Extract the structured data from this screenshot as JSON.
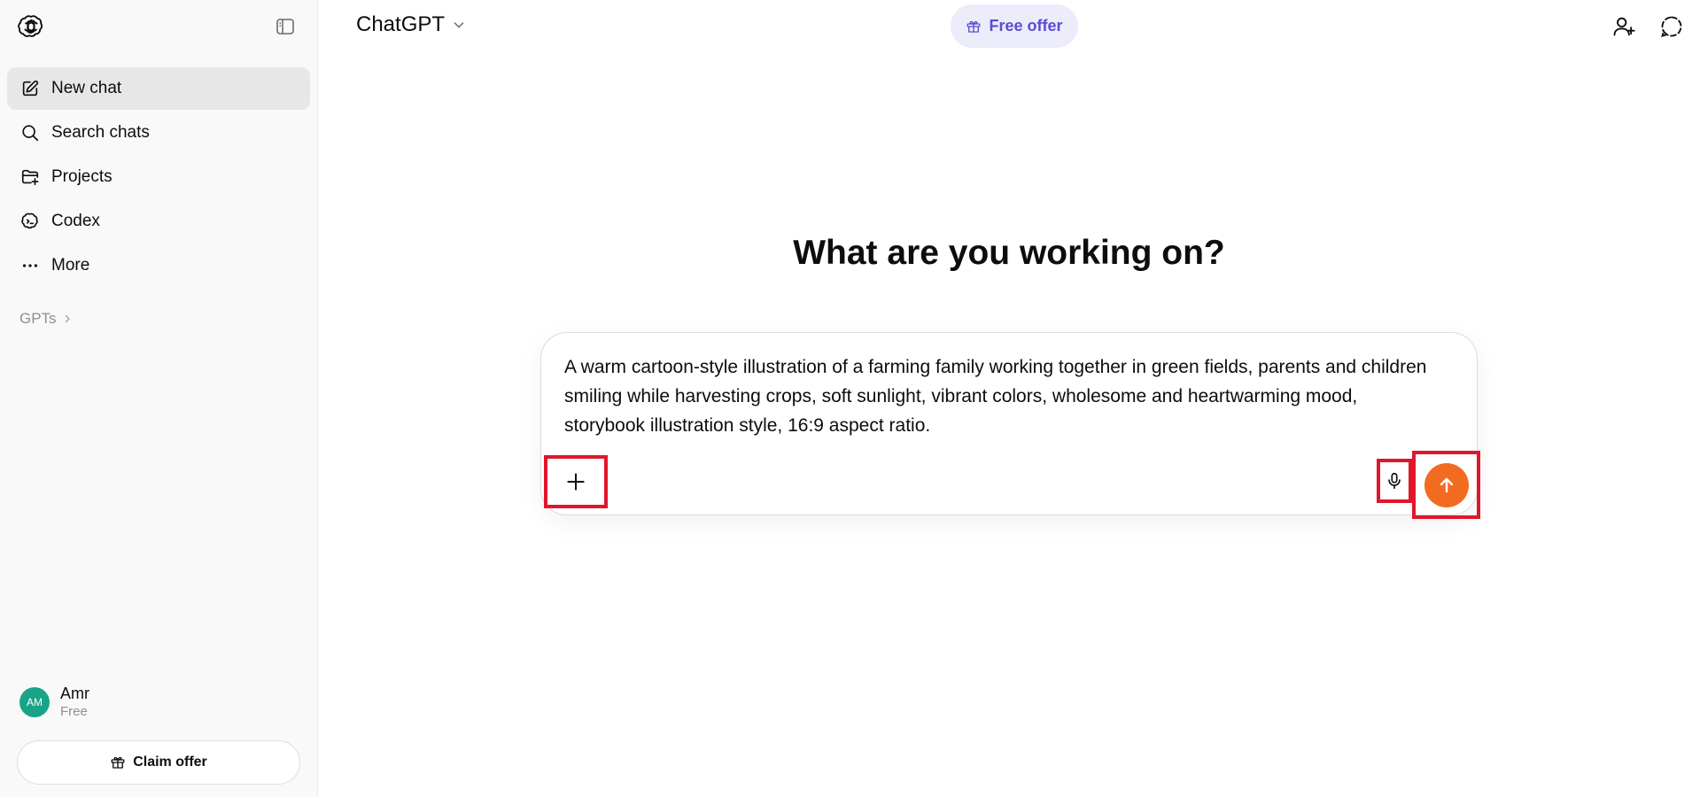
{
  "sidebar": {
    "items": [
      {
        "label": "New chat",
        "icon": "edit-icon"
      },
      {
        "label": "Search chats",
        "icon": "search-icon"
      },
      {
        "label": "Projects",
        "icon": "folder-plus-icon"
      },
      {
        "label": "Codex",
        "icon": "codex-icon"
      },
      {
        "label": "More",
        "icon": "more-dots-icon"
      }
    ],
    "gpts_label": "GPTs",
    "user": {
      "initials": "AM",
      "name": "Amr",
      "plan": "Free"
    },
    "claim_label": "Claim offer"
  },
  "header": {
    "model_label": "ChatGPT",
    "free_offer_label": "Free offer"
  },
  "main": {
    "heading": "What are you working on?",
    "prompt_text": "A warm cartoon-style illustration of a farming family working together in green fields, parents and children smiling while harvesting crops, soft sunlight, vibrant colors, wholesome and heartwarming mood, storybook illustration style, 16:9 aspect ratio."
  },
  "colors": {
    "accent": "#f36b21",
    "highlight_box": "#e0162b",
    "offer_bg": "#ececfb",
    "offer_text": "#5a4fcf",
    "avatar_bg": "#19a489"
  }
}
